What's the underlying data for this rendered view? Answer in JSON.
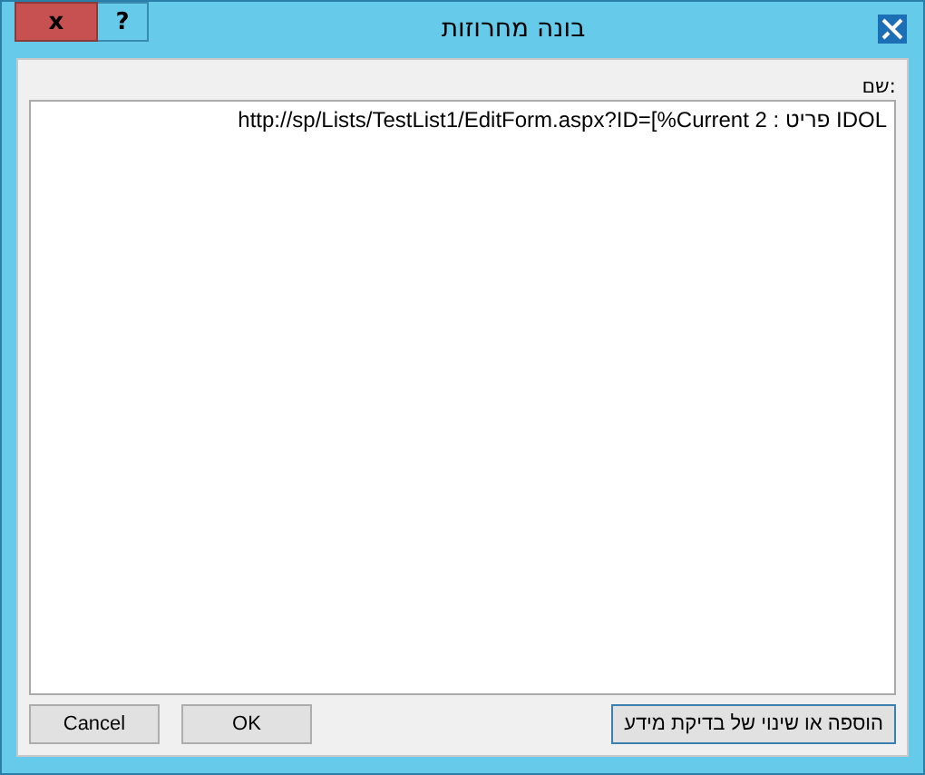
{
  "window": {
    "title": "בונה מחרוזות",
    "close": "x",
    "help": "?"
  },
  "name_field": {
    "label": "שם:",
    "value": "http://sp/Lists/TestList1/EditForm.aspx?ID=[%Current פריט : 2 IDOL"
  },
  "buttons": [
    {
      "label": "הוספה או שינוי של בדיקת מידע",
      "kind": "lookup"
    },
    {
      "label": "OK",
      "kind": "ok"
    },
    {
      "label": "Cancel",
      "kind": "cancel"
    }
  ]
}
